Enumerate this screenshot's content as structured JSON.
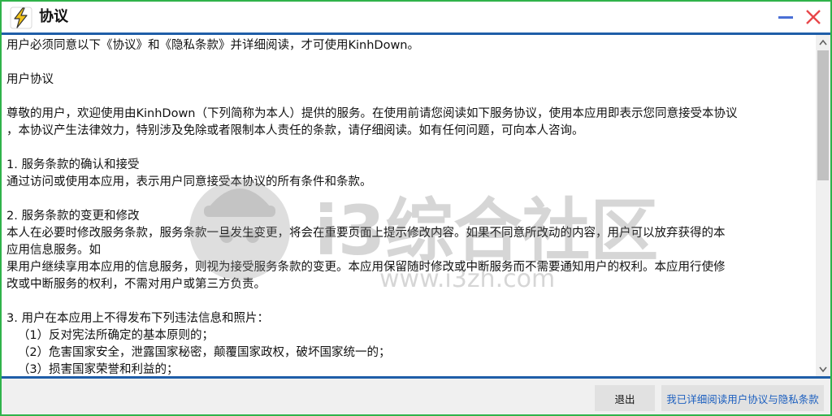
{
  "window": {
    "title": "协议",
    "icon": "lightning-bolt-icon"
  },
  "titlebar_buttons": {
    "minimize": "minimize-icon",
    "close": "close-icon"
  },
  "content": {
    "lines": [
      "用户必须同意以下《协议》和《隐私条款》并详细阅读，才可使用KinhDown。",
      "",
      "用户协议",
      "",
      "尊敬的用户，欢迎使用由KinhDown（下列简称为本人）提供的服务。在使用前请您阅读如下服务协议，使用本应用即表示您同意接受本协议",
      "，本协议产生法律效力，特别涉及免除或者限制本人责任的条款，请仔细阅读。如有任何问题，可向本人咨询。",
      "",
      "1. 服务条款的确认和接受",
      "通过访问或使用本应用，表示用户同意接受本协议的所有条件和条款。",
      "",
      "2. 服务条款的变更和修改",
      "本人在必要时修改服务条款，服务条款一旦发生变更，将会在重要页面上提示修改内容。如果不同意所改动的内容，用户可以放弃获得的本",
      "应用信息服务。如",
      "果用户继续享用本应用的信息服务，则视为接受服务条款的变更。本应用保留随时修改或中断服务而不需要通知用户的权利。本应用行使修",
      "改或中断服务的权利，不需对用户或第三方负责。",
      "",
      "3. 用户在本应用上不得发布下列违法信息和照片：",
      "   （1）反对宪法所确定的基本原则的；",
      "   （2）危害国家安全，泄露国家秘密，颠覆国家政权，破坏国家统一的；",
      "   （3）损害国家荣誉和利益的；"
    ]
  },
  "watermark": {
    "text": "i3综合社区",
    "url": "www.i3zh.com"
  },
  "footer": {
    "exit_label": "退出",
    "agree_label": "我已详细阅读用户协议与隐私条款"
  },
  "colors": {
    "border": "#2fb34a",
    "rule": "#1f5ea8",
    "agree_text": "#1c5fbf",
    "close_icon": "#e8474a",
    "minimize_icon": "#4a6fd6"
  }
}
